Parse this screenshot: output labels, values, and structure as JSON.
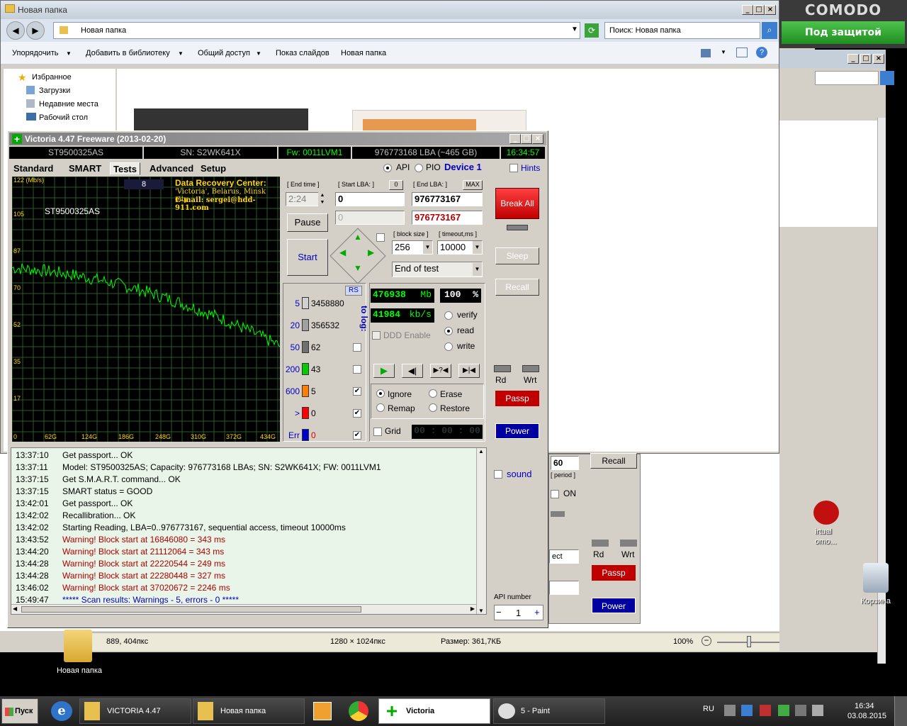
{
  "explorer": {
    "title": "Новая папка",
    "address": "Новая папка",
    "search_placeholder": "Поиск: Новая папка",
    "commands": [
      "Упорядочить",
      "Добавить в библиотеку",
      "Общий доступ",
      "Показ слайдов",
      "Новая папка"
    ],
    "nav": [
      "Избранное",
      "Загрузки",
      "Недавние места",
      "Рабочий стол"
    ]
  },
  "comodo": {
    "title": "COMODO",
    "status": "Под защитой"
  },
  "paint_status": {
    "cursor": "889, 404пкс",
    "size": "1280 × 1024пкс",
    "filesize": "Размер: 361,7КБ",
    "zoom": "100%"
  },
  "victoria": {
    "title": "Victoria 4.47  Freeware (2013-02-20)",
    "model": "ST9500325AS",
    "serial": "SN: S2WK641X",
    "firmware": "Fw: 0011LVM1",
    "capacity": "976773168 LBA (~465 GB)",
    "clock": "16:34:57",
    "tabs": [
      "Standard",
      "SMART",
      "Tests",
      "Advanced",
      "Setup"
    ],
    "mode_api": "API",
    "mode_pio": "PIO",
    "device": "Device 1",
    "hints": "Hints",
    "graph": {
      "unit": "122 (Mb/s)",
      "counter": "8",
      "drive_label": "ST9500325AS",
      "center_title": "Data Recovery Center:",
      "center_line2": "'Victoria', Belarus, Minsk city",
      "center_line3": "E-mail: sergei@hdd-911.com",
      "y_ticks": [
        "105",
        "87",
        "70",
        "52",
        "35",
        "17",
        "0"
      ],
      "x_ticks": [
        "62G",
        "124G",
        "186G",
        "248G",
        "310G",
        "372G",
        "434G"
      ]
    },
    "controls": {
      "end_time_label": "[ End time ]",
      "end_time": "2:24",
      "start_lba_label": "[ Start LBA: ]",
      "start_lba_zero": "0",
      "start_lba": "0",
      "start_lba_current": "0",
      "end_lba_label": "[ End LBA: ]",
      "max": "MAX",
      "end_lba": "976773167",
      "end_lba_current": "976773167",
      "pause": "Pause",
      "start": "Start",
      "block_size_label": "[ block size ]",
      "block_size": "256",
      "timeout_label": "[ timeout,ms ]",
      "timeout": "10000",
      "end_mode": "End of test"
    },
    "histogram": {
      "rs": "RS",
      "to_log": "to log:",
      "rows": [
        {
          "label": "5",
          "count": "3458880",
          "color": "#d0d0d0"
        },
        {
          "label": "20",
          "count": "356532",
          "color": "#a0a0a0"
        },
        {
          "label": "50",
          "count": "62",
          "color": "#707070"
        },
        {
          "label": "200",
          "count": "43",
          "color": "#00cc00"
        },
        {
          "label": "600",
          "count": "5",
          "color": "#ff8000"
        },
        {
          "label": ">",
          "count": "0",
          "color": "#ff0000"
        },
        {
          "label": "Err",
          "count": "0",
          "color": "#0000cc"
        }
      ]
    },
    "stats": {
      "mb": "476938",
      "mb_unit": "Mb",
      "percent": "100",
      "percent_unit": "%",
      "speed": "41984",
      "speed_unit": "kb/s",
      "ddd": "DDD Enable",
      "verify": "verify",
      "read": "read",
      "write": "write",
      "ignore": "Ignore",
      "erase": "Erase",
      "remap": "Remap",
      "restore": "Restore",
      "grid": "Grid",
      "grid_time": "00 : 00 : 00"
    },
    "side": {
      "break_all": "Break All",
      "sleep": "Sleep",
      "recall": "Recall",
      "rd": "Rd",
      "wrt": "Wrt",
      "passp": "Passp",
      "power": "Power",
      "sound": "sound",
      "api_number_label": "API number",
      "api_number": "1"
    },
    "log": [
      {
        "time": "13:37:10",
        "msg": "Get passport... OK",
        "kind": "normal"
      },
      {
        "time": "13:37:11",
        "msg": "Model: ST9500325AS; Capacity: 976773168 LBAs; SN: S2WK641X; FW: 0011LVM1",
        "kind": "normal"
      },
      {
        "time": "13:37:15",
        "msg": "Get S.M.A.R.T. command... OK",
        "kind": "normal"
      },
      {
        "time": "13:37:15",
        "msg": "SMART status = GOOD",
        "kind": "normal"
      },
      {
        "time": "13:42:01",
        "msg": "Get passport... OK",
        "kind": "normal"
      },
      {
        "time": "13:42:02",
        "msg": "Recallibration... OK",
        "kind": "normal"
      },
      {
        "time": "13:42:02",
        "msg": "Starting Reading, LBA=0..976773167, sequential access, timeout 10000ms",
        "kind": "normal"
      },
      {
        "time": "13:43:52",
        "msg": "Warning! Block start at 16846080 = 343 ms",
        "kind": "warn"
      },
      {
        "time": "13:44:20",
        "msg": "Warning! Block start at 21112064 = 343 ms",
        "kind": "warn"
      },
      {
        "time": "13:44:28",
        "msg": "Warning! Block start at 22220544 = 249 ms",
        "kind": "warn"
      },
      {
        "time": "13:44:28",
        "msg": "Warning! Block start at 22280448 = 327 ms",
        "kind": "warn"
      },
      {
        "time": "13:46:02",
        "msg": "Warning! Block start at 37020672 = 2246 ms",
        "kind": "warn"
      },
      {
        "time": "15:49:47",
        "msg": "***** Scan results: Warnings - 5, errors - 0 *****",
        "kind": "info"
      }
    ]
  },
  "behind_window": {
    "recall": "Recall",
    "period": "[ period ]",
    "period_value": "60",
    "on": "ON",
    "rd": "Rd",
    "wrt": "Wrt",
    "passp": "Passp",
    "power": "Power",
    "select_partial": "ect"
  },
  "desktop": {
    "folder_label": "Новая папка",
    "recycle_label": "Корзина",
    "virtual_label_1": "irtual",
    "virtual_label_2": "omo..."
  },
  "taskbar": {
    "start": "Пуск",
    "tasks": [
      "VICTORIA 4.47",
      "Новая папка",
      "Victoria",
      "5 - Paint"
    ],
    "lang": "RU",
    "time": "16:34",
    "date": "03.08.2015"
  },
  "colors": {
    "warn": "#b00000",
    "info": "#0000c0",
    "graph_line": "#00ff00",
    "break_all": "#e00000"
  }
}
